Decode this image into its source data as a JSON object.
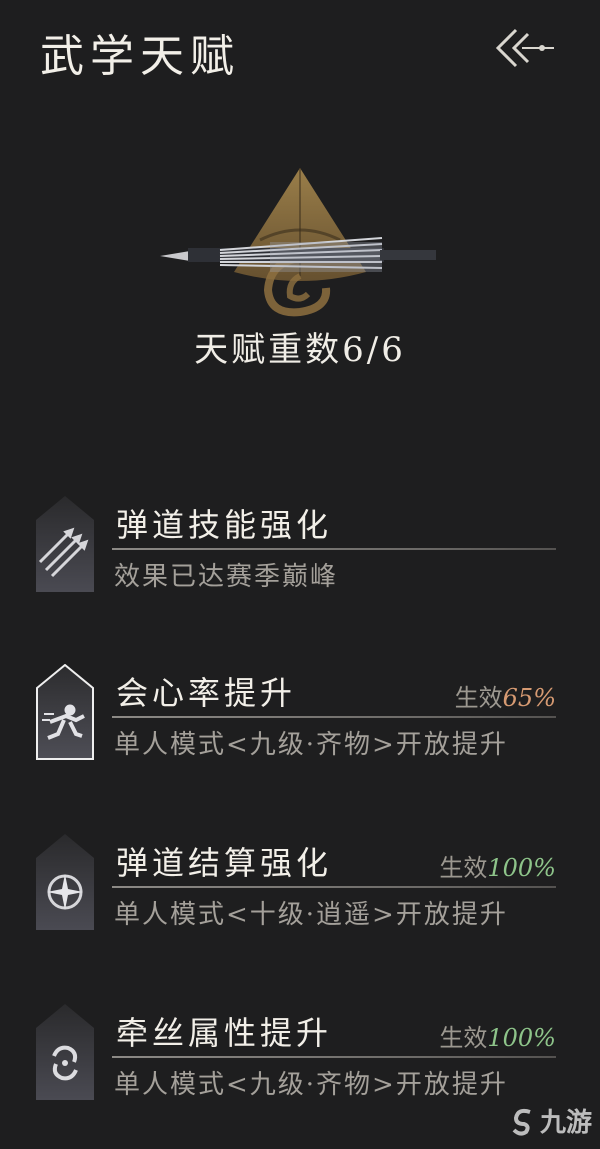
{
  "header": {
    "title": "武学天赋",
    "back_icon": "double-chevron-left-icon"
  },
  "summary": {
    "talent_count": "天赋重数6/6",
    "emblem_icon": "hat-and-arrows-emblem-icon"
  },
  "talents": [
    {
      "title": "弹道技能强化",
      "status_label": "",
      "status_value": "",
      "description": "效果已达赛季巅峰",
      "icon": "triple-arrows-icon",
      "status_color": ""
    },
    {
      "title": "会心率提升",
      "status_label": "生效",
      "status_value": "65%",
      "description": "单人模式<九级·齐物>开放提升",
      "icon": "crit-strike-figure-icon",
      "status_color": "#d69a72",
      "selected": true
    },
    {
      "title": "弹道结算强化",
      "status_label": "生效",
      "status_value": "100%",
      "description": "单人模式<十级·逍遥>开放提升",
      "icon": "star-target-icon",
      "status_color": "#8ec48a"
    },
    {
      "title": "牵丝属性提升",
      "status_label": "生效",
      "status_value": "100%",
      "description": "单人模式<九级·齐物>开放提升",
      "icon": "swirl-icon",
      "status_color": "#8ec48a"
    }
  ],
  "watermark": {
    "text": "九游",
    "icon": "jiuyou-logo-icon"
  }
}
